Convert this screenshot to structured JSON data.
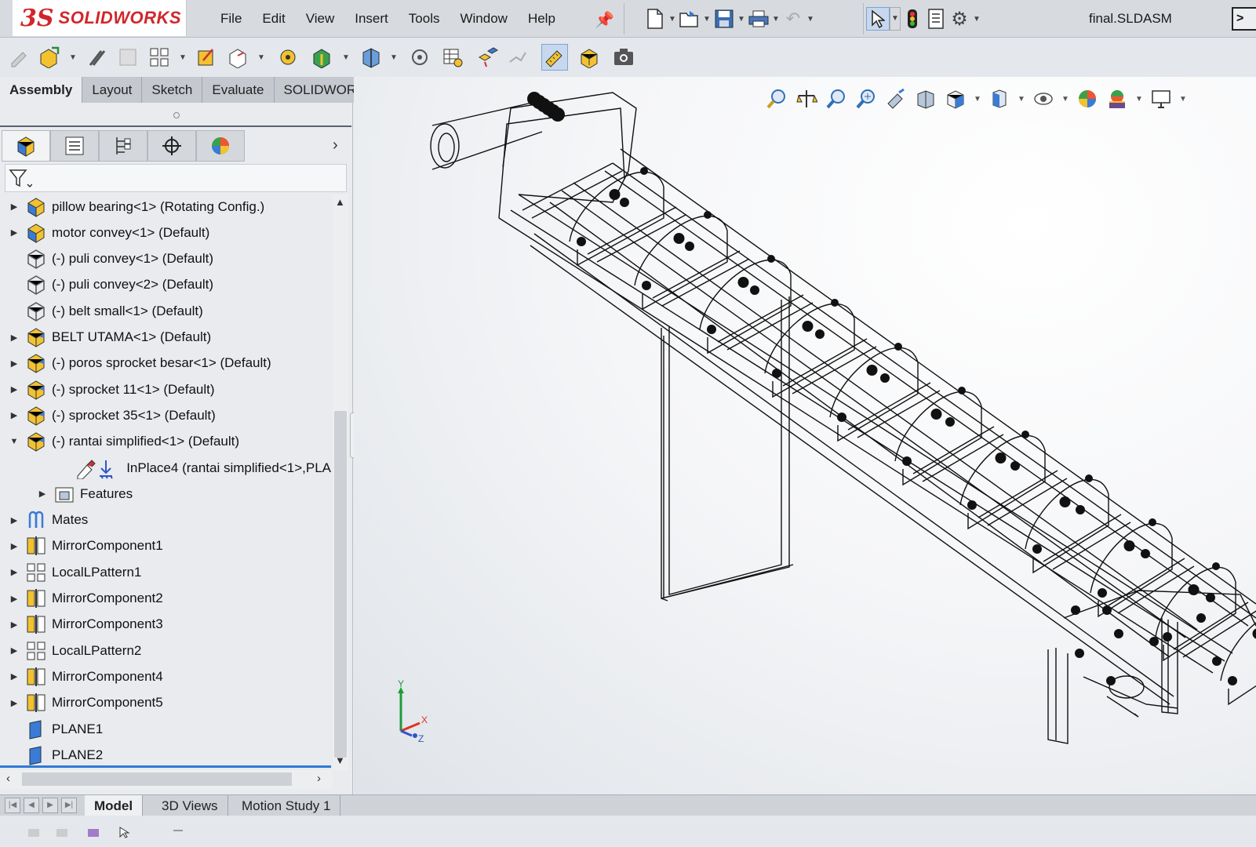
{
  "app": {
    "logo_mark": "3S",
    "logo_text": "SOLIDWORKS"
  },
  "menu": [
    "File",
    "Edit",
    "View",
    "Insert",
    "Tools",
    "Window",
    "Help"
  ],
  "document": {
    "title": "final.SLDASM"
  },
  "tabs": [
    {
      "label": "Assembly",
      "active": true
    },
    {
      "label": "Layout",
      "active": false
    },
    {
      "label": "Sketch",
      "active": false
    },
    {
      "label": "Evaluate",
      "active": false
    },
    {
      "label": "SOLIDWORKS Add-Ins",
      "active": false
    }
  ],
  "tree": [
    {
      "label": "pillow bearing<1> (Rotating Config.)",
      "expand": "right",
      "icon": "part-assembly-icon",
      "indent": 0
    },
    {
      "label": "motor convey<1> (Default)",
      "expand": "right",
      "icon": "part-assembly-icon",
      "indent": 0
    },
    {
      "label": "(-) puli convey<1> (Default)",
      "expand": "none",
      "icon": "part-wireframe-icon",
      "indent": 0
    },
    {
      "label": "(-) puli convey<2> (Default)",
      "expand": "none",
      "icon": "part-wireframe-icon",
      "indent": 0
    },
    {
      "label": "(-) belt small<1> (Default)",
      "expand": "none",
      "icon": "part-wireframe-icon",
      "indent": 0
    },
    {
      "label": "BELT UTAMA<1> (Default)",
      "expand": "right",
      "icon": "subassembly-icon",
      "indent": 0
    },
    {
      "label": "(-) poros sprocket besar<1> (Default)",
      "expand": "right",
      "icon": "subassembly-icon",
      "indent": 0
    },
    {
      "label": "(-) sprocket 11<1> (Default)",
      "expand": "right",
      "icon": "subassembly-icon",
      "indent": 0
    },
    {
      "label": "(-) sprocket 35<1> (Default)",
      "expand": "right",
      "icon": "subassembly-icon",
      "indent": 0
    },
    {
      "label": "(-) rantai simplified<1> (Default)",
      "expand": "down",
      "icon": "subassembly-icon",
      "indent": 0
    },
    {
      "label": "InPlace4 (rantai simplified<1>,PLA",
      "expand": "none",
      "icon": "inplace-mate-icon",
      "indent": 2
    },
    {
      "label": "Features",
      "expand": "right",
      "icon": "features-folder-icon",
      "indent": 1
    },
    {
      "label": "Mates",
      "expand": "right",
      "icon": "mates-icon",
      "indent": 0
    },
    {
      "label": "MirrorComponent1",
      "expand": "right",
      "icon": "mirror-component-icon",
      "indent": 0
    },
    {
      "label": "LocalLPattern1",
      "expand": "right",
      "icon": "linear-pattern-icon",
      "indent": 0
    },
    {
      "label": "MirrorComponent2",
      "expand": "right",
      "icon": "mirror-component-icon",
      "indent": 0
    },
    {
      "label": "MirrorComponent3",
      "expand": "right",
      "icon": "mirror-component-icon",
      "indent": 0
    },
    {
      "label": "LocalLPattern2",
      "expand": "right",
      "icon": "linear-pattern-icon",
      "indent": 0
    },
    {
      "label": "MirrorComponent4",
      "expand": "right",
      "icon": "mirror-component-icon",
      "indent": 0
    },
    {
      "label": "MirrorComponent5",
      "expand": "right",
      "icon": "mirror-component-icon",
      "indent": 0
    },
    {
      "label": "PLANE1",
      "expand": "none",
      "icon": "plane-icon",
      "indent": 0
    },
    {
      "label": "PLANE2",
      "expand": "none",
      "icon": "plane-icon",
      "indent": 0
    }
  ],
  "triad": {
    "x": "X",
    "y": "Y",
    "z": "Z"
  },
  "bottom_tabs": [
    {
      "label": "Model",
      "active": true
    },
    {
      "label": "3D Views",
      "active": false
    },
    {
      "label": "Motion Study 1",
      "active": false
    }
  ],
  "colors": {
    "brand_red": "#d1262b",
    "selection_blue": "#2f7ad6",
    "part_yellow": "#f2c230"
  }
}
